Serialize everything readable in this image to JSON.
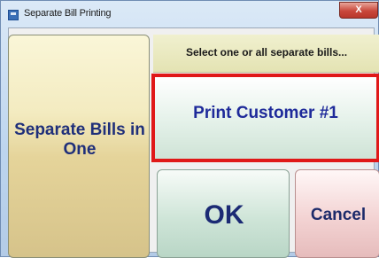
{
  "window": {
    "title": "Separate Bill Printing",
    "close_label": "X"
  },
  "left_button": {
    "label": "Separate Bills in One"
  },
  "prompt": {
    "text": "Select one or all separate bills..."
  },
  "print_button": {
    "label": "Print Customer #1"
  },
  "ok_button": {
    "label": "OK"
  },
  "cancel_button": {
    "label": "Cancel"
  },
  "colors": {
    "selection_border": "#e01818",
    "text_blue": "#1e2a9a"
  },
  "icons": {
    "app": "window-app-icon",
    "close": "close-icon"
  }
}
